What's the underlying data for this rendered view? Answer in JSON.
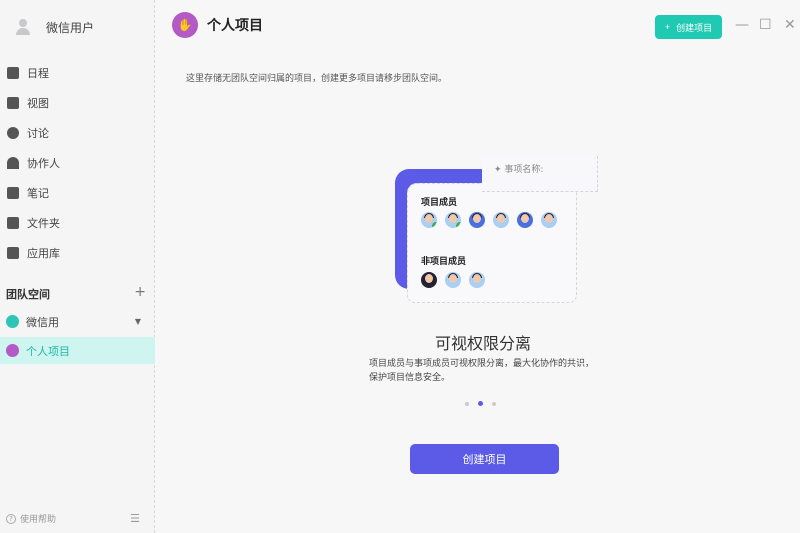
{
  "sidebar": {
    "user": "微信用户",
    "items": [
      {
        "label": "日程",
        "icon": "calendar-icon"
      },
      {
        "label": "视图",
        "icon": "chart-icon"
      },
      {
        "label": "讨论",
        "icon": "chat-icon"
      },
      {
        "label": "协作人",
        "icon": "people-icon"
      },
      {
        "label": "笔记",
        "icon": "note-icon"
      },
      {
        "label": "文件夹",
        "icon": "folder-icon"
      },
      {
        "label": "应用库",
        "icon": "apps-icon"
      }
    ],
    "section": "团队空间",
    "section_add": "+",
    "teams": [
      {
        "label": "微信用",
        "color": "#2ec4b6"
      },
      {
        "label": "个人项目",
        "color": "#b35ac6"
      }
    ],
    "help": "使用帮助",
    "help_icon": "?",
    "menu_icon": "☰"
  },
  "header": {
    "title": "个人项目",
    "create": "创建项目",
    "create_icon": "+",
    "minimize": "—",
    "maximize": "☐",
    "close": "✕"
  },
  "description": "这里存储无团队空间归属的项目，创建更多项目请移步团队空间。",
  "illustration": {
    "tag": "事项名称:",
    "members_label": "项目成员",
    "non_members_label": "非项目成员"
  },
  "carousel": {
    "title": "可视权限分离",
    "text": "项目成员与事项成员可视权限分离，最大化协作的共识，保护项目信息安全。",
    "active": 2,
    "total": 3
  },
  "cta": "创建项目"
}
